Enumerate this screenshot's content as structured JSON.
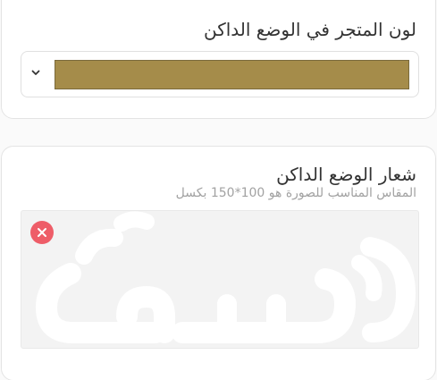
{
  "color_setting": {
    "title": "لون المتجر في الوضع الداكن",
    "selected_color": "#a58c4a",
    "dropdown_icon": "chevron-down-icon"
  },
  "logo_setting": {
    "title": "شعار الوضع الداكن",
    "hint": "المقاس المناسب للصورة هو 100*150 بكسل",
    "remove_icon": "close-icon",
    "remove_color": "#ee5d68"
  }
}
